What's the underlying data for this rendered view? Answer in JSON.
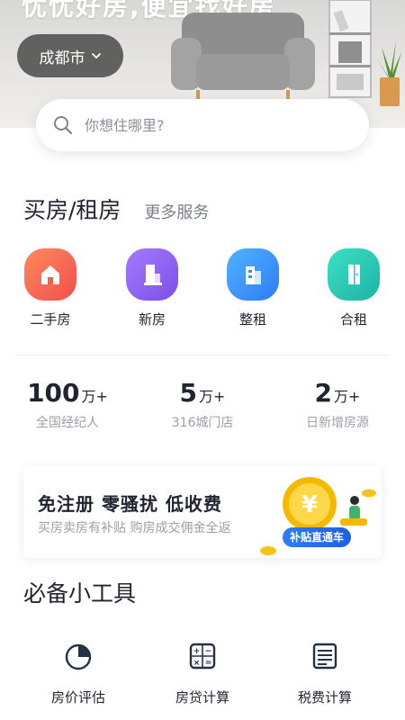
{
  "hero": {
    "slogan": "忧忧好房,便宜找好房",
    "city": "成都市",
    "search_placeholder": "你想住哪里?"
  },
  "section_buy_rent": {
    "title": "买房/租房",
    "more": "更多服务"
  },
  "quick_entries": [
    {
      "label": "二手房",
      "icon": "house-icon",
      "color": "#f46a4f"
    },
    {
      "label": "新房",
      "icon": "building-icon",
      "color": "#8e61f0"
    },
    {
      "label": "整租",
      "icon": "apartment-icon",
      "color": "#3a92f4"
    },
    {
      "label": "合租",
      "icon": "door-icon",
      "color": "#28c7b4"
    }
  ],
  "stats": [
    {
      "number": "100",
      "unit": "万+",
      "label": "全国经纪人"
    },
    {
      "number": "5",
      "unit": "万+",
      "label": "316城门店"
    },
    {
      "number": "2",
      "unit": "万+",
      "label": "日新增房源"
    }
  ],
  "promo": {
    "title": "免注册 零骚扰 低收费",
    "subtitle": "买房卖房有补贴 购房成交佣金全返",
    "badge": "补贴直通车",
    "coin_symbol": "¥"
  },
  "tools": {
    "title": "必备小工具",
    "items": [
      {
        "label": "房价评估",
        "icon": "pie-chart-icon"
      },
      {
        "label": "房贷计算",
        "icon": "calculator-icon"
      },
      {
        "label": "税费计算",
        "icon": "receipt-icon"
      }
    ]
  },
  "colors": {
    "text": "#1f2430",
    "muted": "#9aa0a8",
    "accent_blue": "#2f7cf6",
    "coin": "#f6b800"
  }
}
